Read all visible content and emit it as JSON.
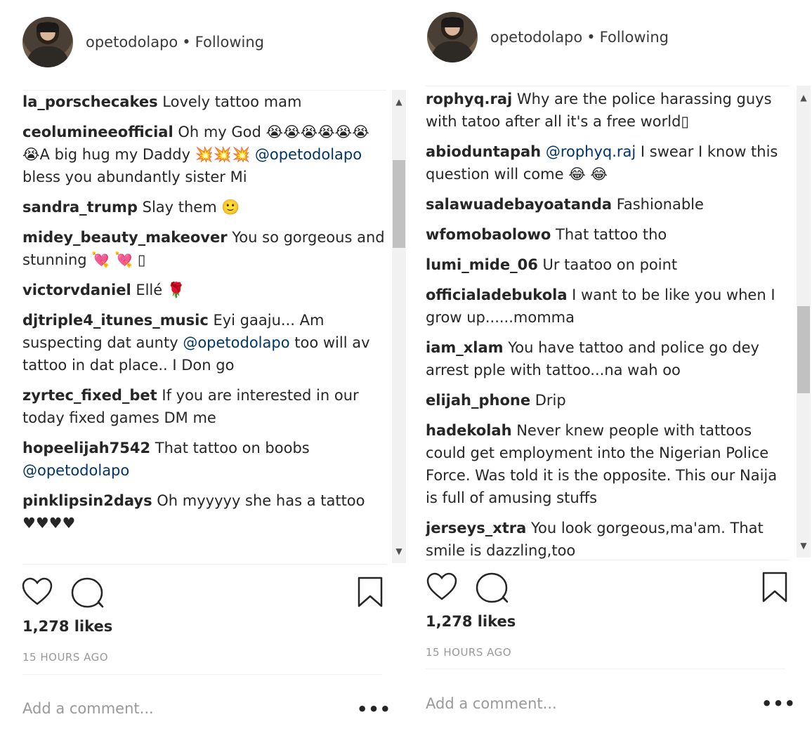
{
  "left": {
    "username": "opetodolapo",
    "separator": "•",
    "follow_label": "Following",
    "comments": [
      {
        "user": "la_porschecakes",
        "text": " Lovely tattoo mam",
        "mention": "",
        "tail": ""
      },
      {
        "user": "ceolumineeofficial",
        "text": " Oh my God 😭😭😭😭😭😭😭A big hug my Daddy 💥💥💥 ",
        "mention": "@opetodolapo",
        "tail": " bless you abundantly sister Mi"
      },
      {
        "user": "sandra_trump",
        "text": " Slay them 🙂",
        "mention": "",
        "tail": ""
      },
      {
        "user": "midey_beauty_makeover",
        "text": " You so gorgeous and stunning 💘 💘 ▯",
        "mention": "",
        "tail": ""
      },
      {
        "user": "victorvdaniel",
        "text": " Ellé 🌹",
        "mention": "",
        "tail": ""
      },
      {
        "user": "djtriple4_itunes_music",
        "text": " Eyi gaaju... Am suspecting dat aunty ",
        "mention": "@opetodolapo",
        "tail": " too will av tattoo in dat place.. I Don go"
      },
      {
        "user": "zyrtec_fixed_bet",
        "text": " If you are interested in our today fixed games DM me",
        "mention": "",
        "tail": ""
      },
      {
        "user": "hopeelijah7542",
        "text": " That tattoo on boobs ",
        "mention": "@opetodolapo",
        "tail": ""
      },
      {
        "user": "pinklipsin2days",
        "text": " Oh myyyyy she has a tattoo ♥♥♥♥",
        "mention": "",
        "tail": ""
      }
    ],
    "likes": "1,278 likes",
    "time": "15 HOURS AGO",
    "add_comment_placeholder": "Add a comment...",
    "more_label": "•••"
  },
  "right": {
    "username": "opetodolapo",
    "separator": "•",
    "follow_label": "Following",
    "comments": [
      {
        "user": "rophyq.raj",
        "text": " Why are the police harassing guys with tatoo after all it's a free world▯",
        "mention": "",
        "tail": ""
      },
      {
        "user": "abioduntapah",
        "text": " ",
        "mention": "@rophyq.raj",
        "tail": " I swear I know this question will come 😂 😂"
      },
      {
        "user": "salawuadebayoatanda",
        "text": " Fashionable",
        "mention": "",
        "tail": ""
      },
      {
        "user": "wfomobaolowo",
        "text": " That tattoo tho",
        "mention": "",
        "tail": ""
      },
      {
        "user": "lumi_mide_06",
        "text": " Ur taatoo on point",
        "mention": "",
        "tail": ""
      },
      {
        "user": "officialadebukola",
        "text": " I want to be like you when I grow up......momma",
        "mention": "",
        "tail": ""
      },
      {
        "user": "iam_xlam",
        "text": " You have tattoo and police go dey arrest pple with tattoo...na wah oo",
        "mention": "",
        "tail": ""
      },
      {
        "user": "elijah_phone",
        "text": " Drip",
        "mention": "",
        "tail": ""
      },
      {
        "user": "hadekolah",
        "text": " Never knew people with tattoos could get employment into the Nigerian Police Force. Was told it is the opposite. This our Naija is full of amusing stuffs",
        "mention": "",
        "tail": ""
      },
      {
        "user": "jerseys_xtra",
        "text": " You look gorgeous,ma'am. That smile is dazzling,too",
        "mention": "",
        "tail": ""
      }
    ],
    "likes": "1,278 likes",
    "time": "15 HOURS AGO",
    "add_comment_placeholder": "Add a comment...",
    "more_label": "•••"
  },
  "icons": {
    "like": "heart-outline-icon",
    "comment": "speech-bubble-icon",
    "save": "bookmark-outline-icon",
    "scroll_up": "scroll-up-arrow-icon",
    "scroll_down": "scroll-down-arrow-icon"
  }
}
